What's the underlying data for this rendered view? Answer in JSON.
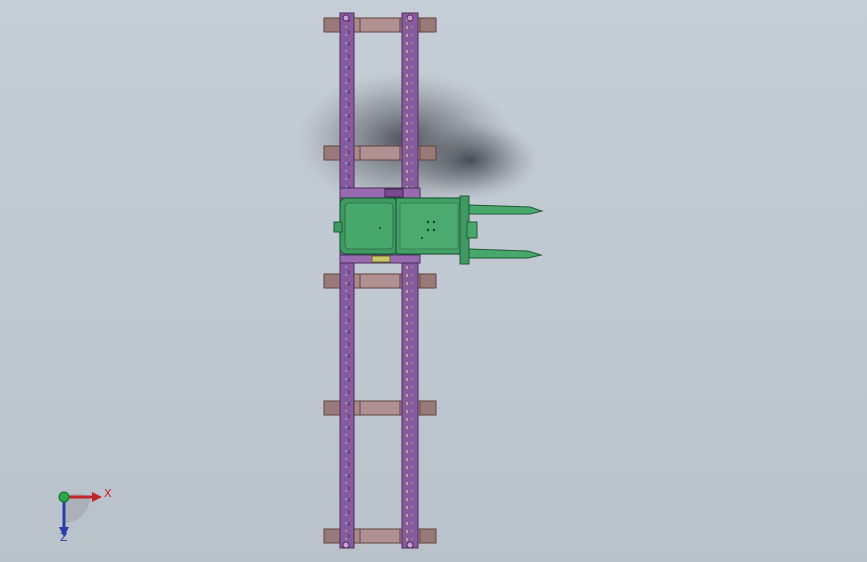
{
  "viewport": {
    "background_top": "#c5cdd6",
    "background_bottom": "#b9c1ca"
  },
  "model": {
    "colors": {
      "rail": "#8a5aa0",
      "rail_edge": "#4a2e5a",
      "crossbar": "#a88a88",
      "crossbar_edge": "#5e4444",
      "body": "#3e9a62",
      "body_edge": "#1f5a38",
      "accent_yellow": "#c8c86a",
      "accent_cyan": "#6ab8c8"
    },
    "crossbar_count": 5
  },
  "triad": {
    "x_label": "X",
    "z_label": "Z",
    "x_color": "#c0262b",
    "z_color": "#2a3ea8",
    "y_color": "#2aa84a"
  }
}
